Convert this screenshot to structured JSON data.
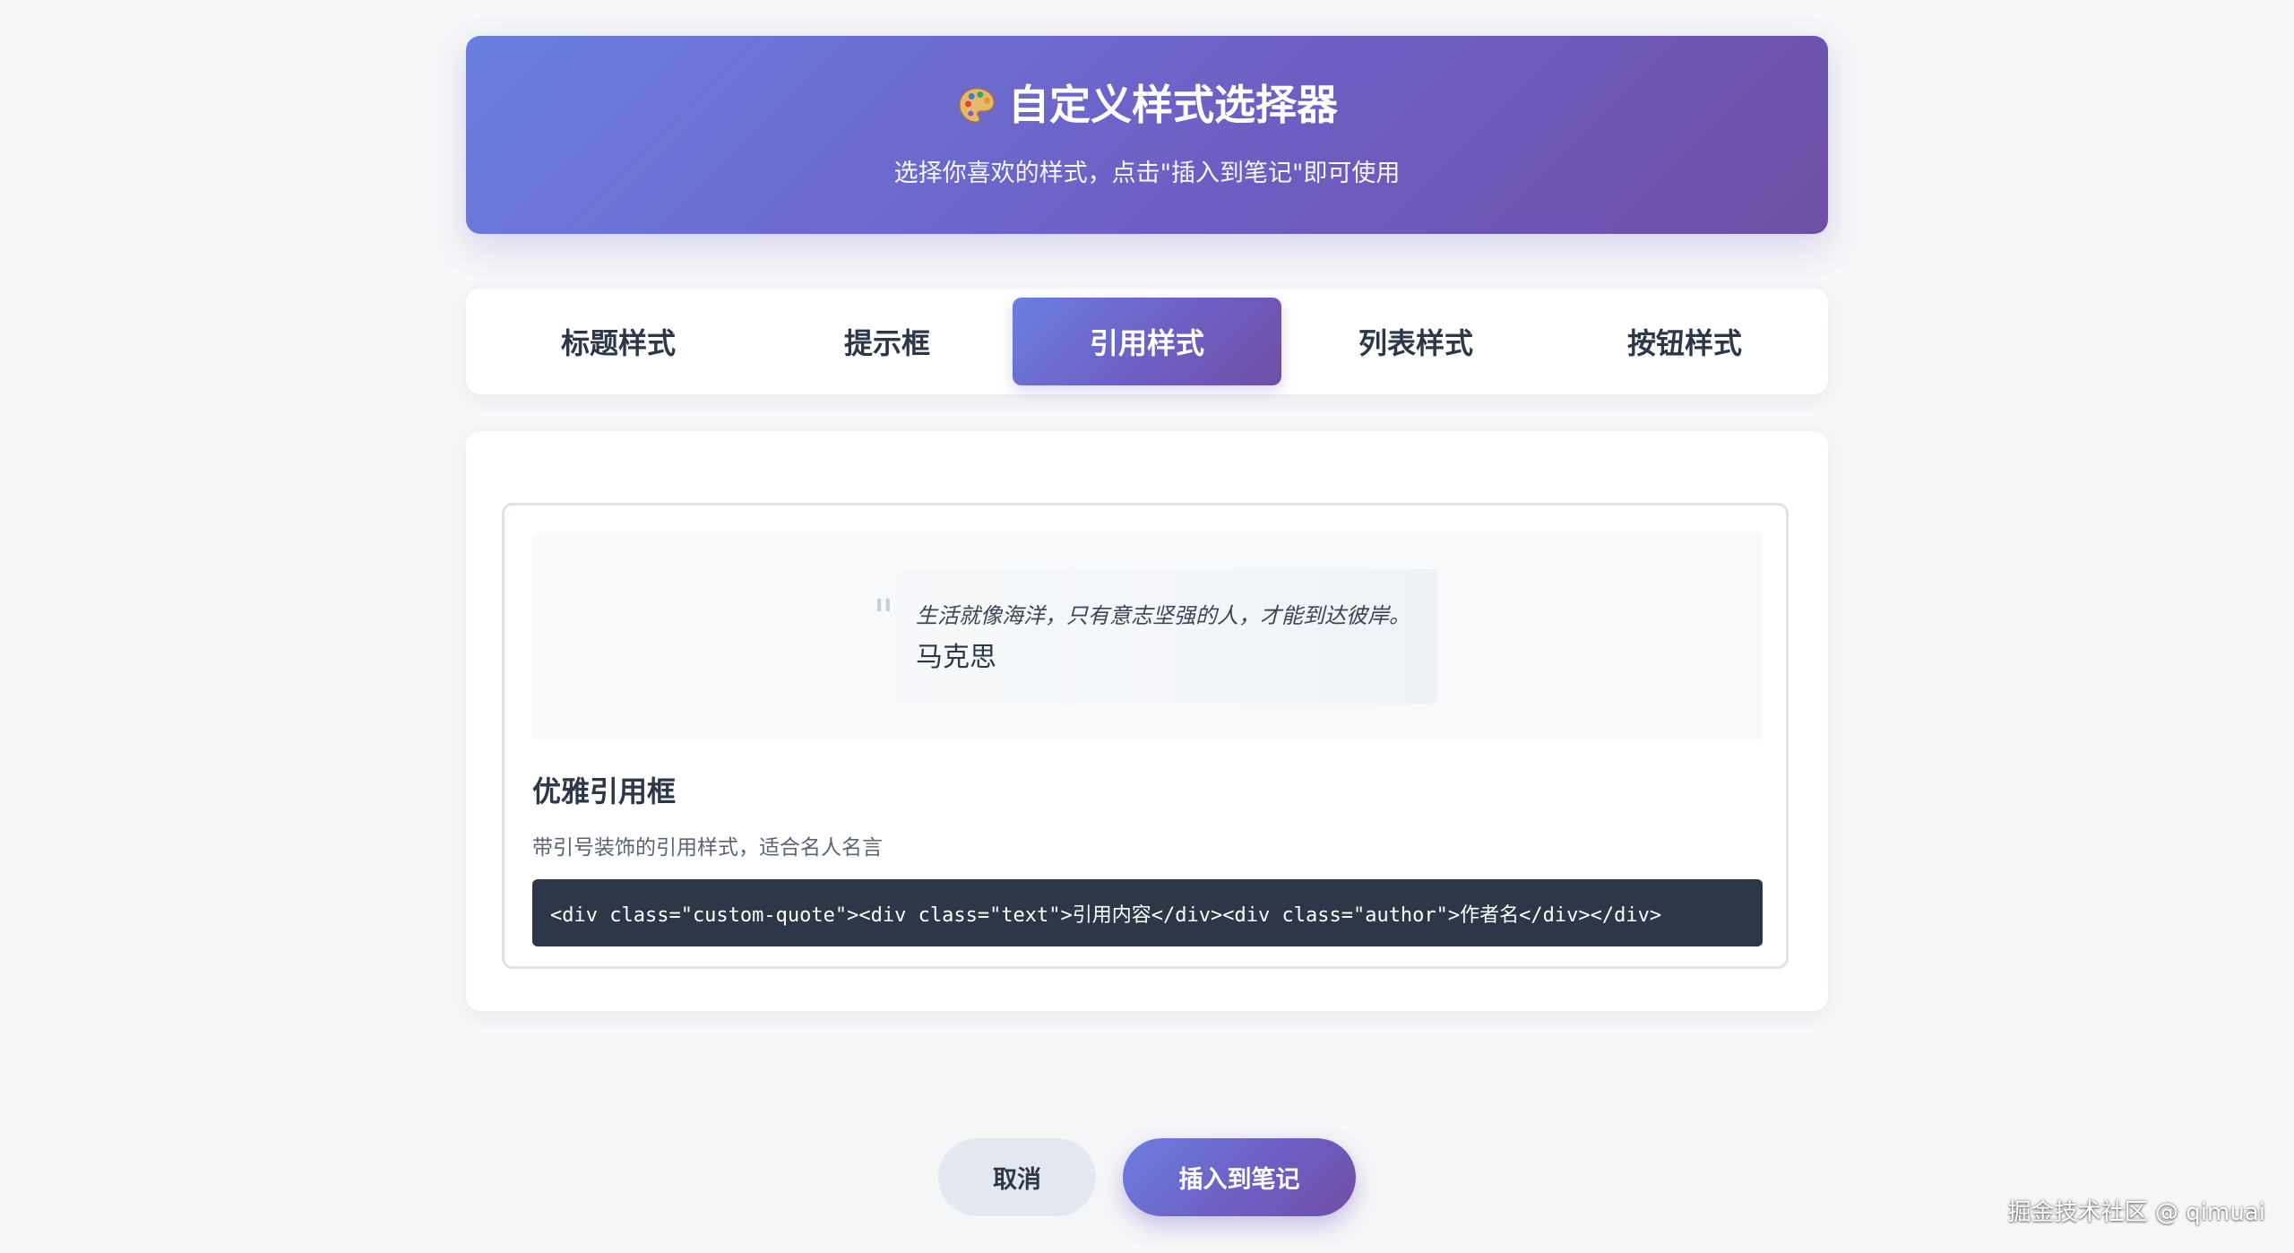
{
  "header": {
    "icon": "palette-icon",
    "title": "自定义样式选择器",
    "subtitle": "选择你喜欢的样式，点击\"插入到笔记\"即可使用"
  },
  "tabs": [
    {
      "label": "标题样式",
      "active": false
    },
    {
      "label": "提示框",
      "active": false
    },
    {
      "label": "引用样式",
      "active": true
    },
    {
      "label": "列表样式",
      "active": false
    },
    {
      "label": "按钮样式",
      "active": false
    }
  ],
  "style_card": {
    "preview": {
      "quote_mark": "\"",
      "text": "生活就像海洋，只有意志坚强的人，才能到达彼岸。",
      "author": "马克思"
    },
    "name": "优雅引用框",
    "description": "带引号装饰的引用样式，适合名人名言",
    "code": "<div class=\"custom-quote\"><div class=\"text\">引用内容</div><div class=\"author\">作者名</div></div>"
  },
  "actions": {
    "cancel_label": "取消",
    "insert_label": "插入到笔记"
  },
  "watermark": "掘金技术社区 @ qimuai",
  "colors": {
    "accent_start": "#6a7fe0",
    "accent_end": "#6f4fa6",
    "code_bg": "#2d3748",
    "page_bg": "#f5f6f8"
  }
}
